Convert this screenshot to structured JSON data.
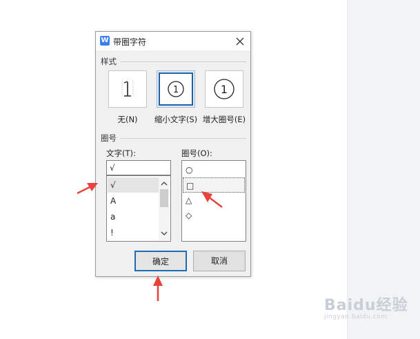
{
  "dialog": {
    "title": "带圈字符",
    "app_icon_letter": "W",
    "style_group_label": "样式",
    "style_options": [
      {
        "glyph": "1",
        "caption": "无(N)"
      },
      {
        "glyph": "①",
        "caption": "缩小文字(S)"
      },
      {
        "glyph": "①",
        "caption": "增大圈号(E)"
      }
    ],
    "selected_style": "缩小文字(S)",
    "circle_group_label": "圈号",
    "text_label": "文字(T):",
    "text_value": "√",
    "text_list": [
      "√",
      "A",
      "a",
      "!"
    ],
    "selected_text": "√",
    "enclosure_label": "圈号(O):",
    "enclosure_list": [
      "○",
      "□",
      "△",
      "◇"
    ],
    "selected_enclosure": "□",
    "ok_label": "确定",
    "cancel_label": "取消"
  },
  "watermark": {
    "brand": "Baidu经验",
    "site": "jingyan.baidu.com"
  },
  "colors": {
    "accent_blue": "#1e6ab5",
    "annotation_arrow": "#e8423b",
    "dialog_bg": "#f0f0f0"
  },
  "icons": {
    "app_icon": "wps-writer-icon",
    "close": "close-icon",
    "scroll_up": "chevron-up-icon",
    "scroll_down": "chevron-down-icon",
    "annotation": "arrow-icon"
  }
}
